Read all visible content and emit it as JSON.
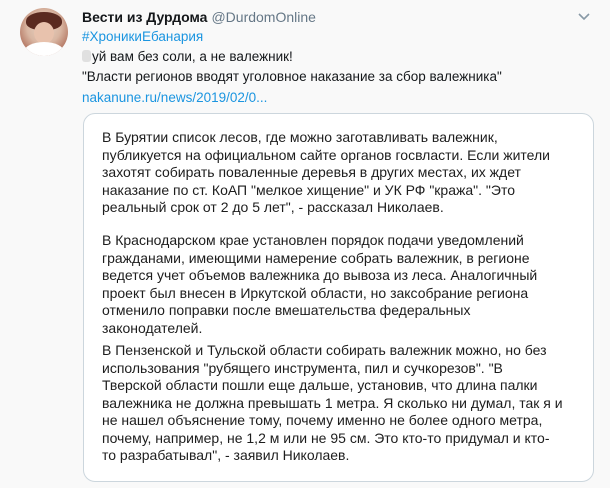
{
  "tweet": {
    "author_name": "Вести из Дурдома",
    "author_handle": "@DurdomOnline",
    "hashtag": "#ХроникиЕбанария",
    "text_line_1": "уй вам без соли, а не валежник!",
    "text_line_2": "\"Власти регионов вводят уголовное наказание за сбор валежника\"",
    "link": "nakanune.ru/news/2019/02/0..."
  },
  "icons": {
    "menu": "chevron-down-icon",
    "avatar": "profile-photo",
    "emoji": "emoji-icon"
  },
  "colors": {
    "link": "#1b95e0",
    "text": "#14171a",
    "muted": "#657786",
    "card_border": "#ccd6dd"
  },
  "image_text": {
    "paragraphs": [
      [
        "В Бурятии список лесов, где можно заготавливать валежник,",
        "публикуется на официальном сайте органов госвласти. Если жители",
        "захотят собирать поваленные деревья в других местах, их ждет",
        "наказание по ст. КоАП \"мелкое хищение\" и УК РФ \"кража\". \"Это",
        "реальный срок от 2 до 5 лет\", - рассказал Николаев."
      ],
      [
        "В Краснодарском крае установлен порядок подачи уведомлений",
        "гражданами, имеющими намерение собрать валежник, в регионе",
        "ведется учет объемов валежника до вывоза из леса. Аналогичный",
        "проект был внесен в Иркутской области, но заксобрание региона",
        "отменило поправки после вмешательства федеральных",
        "законодателей."
      ],
      [
        "В Пензенской и Тульской области собирать валежник можно, но без",
        "использования \"рубящего инструмента, пил и сучкорезов\". \"В",
        "Тверской области пошли еще дальше, установив, что длина палки",
        "валежника не должна превышать 1 метра. Я сколько ни думал, так я и",
        "не нашел объяснение тому, почему именно не более одного метра,",
        "почему, например, не 1,2 м или не 95 см. Это кто-то придумал и кто-",
        "то разрабатывал\", - заявил Николаев."
      ]
    ]
  }
}
